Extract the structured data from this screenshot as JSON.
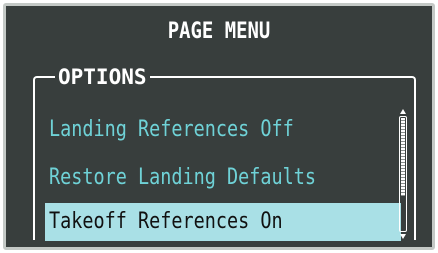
{
  "page_menu": {
    "title": "PAGE MENU",
    "group_label": "OPTIONS",
    "items": [
      {
        "label": "Landing References Off",
        "selected": false
      },
      {
        "label": "Restore Landing Defaults",
        "selected": false
      },
      {
        "label": "Takeoff References On",
        "selected": true
      }
    ]
  },
  "colors": {
    "background": "#383e3d",
    "frame": "#c4c9c6",
    "item_text": "#6fd2d7",
    "selection_highlight": "#a9e0e6",
    "title_text": "#ffffff"
  }
}
